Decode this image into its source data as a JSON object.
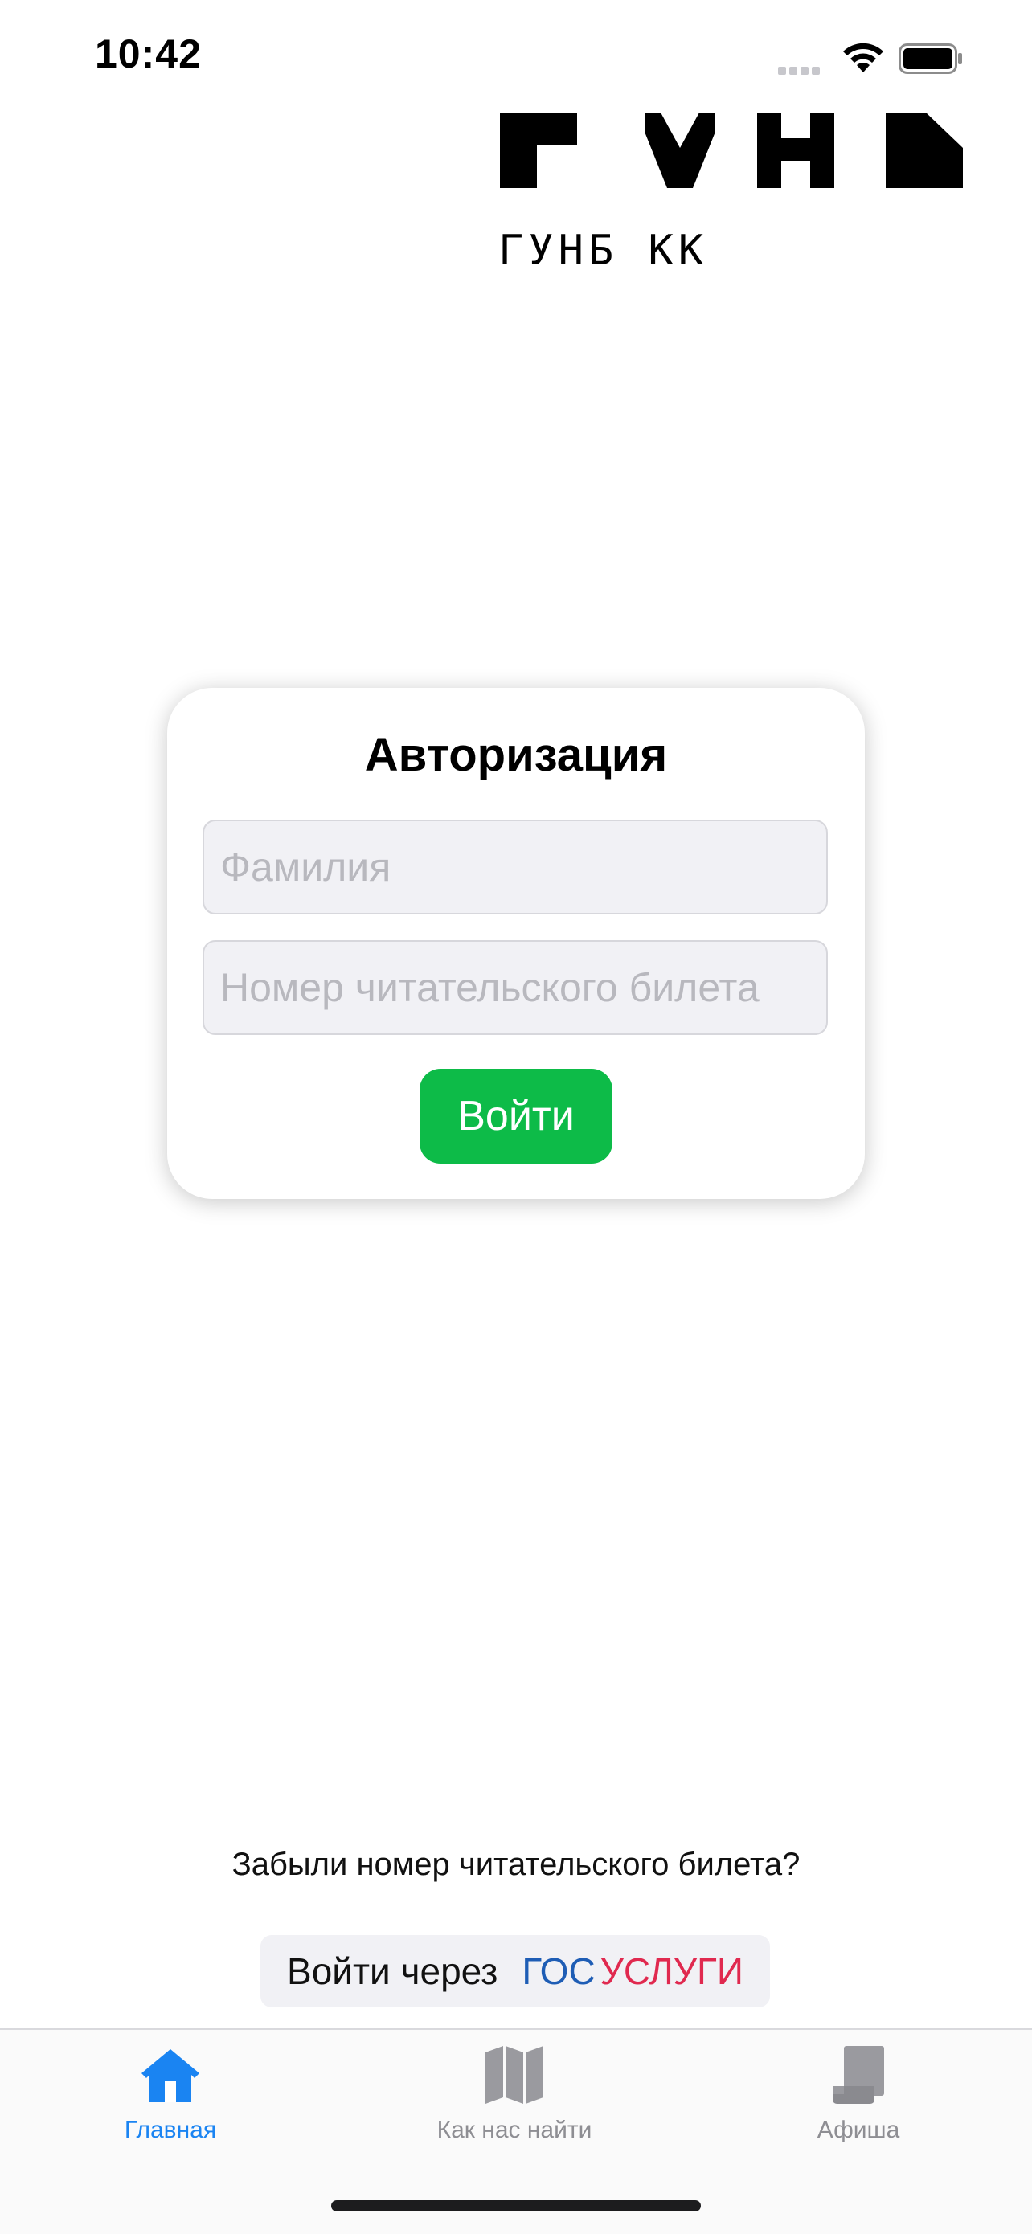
{
  "status_bar": {
    "time": "10:42"
  },
  "logo": {
    "caption": "ГУНБ КК"
  },
  "auth": {
    "title": "Авторизация",
    "surname_placeholder": "Фамилия",
    "surname_value": "",
    "card_placeholder": "Номер читательского билета",
    "card_value": "",
    "login_label": "Войти",
    "login_color": "#0dbb48"
  },
  "links": {
    "forgot": "Забыли номер читательского билета?",
    "gosuslugi_prefix": "Войти через",
    "gosuslugi_gos": "ГОС",
    "gosuslugi_uslugi": "УСЛУГИ"
  },
  "tabs": [
    {
      "label": "Главная",
      "icon": "home-icon",
      "active": true
    },
    {
      "label": "Как нас найти",
      "icon": "map-icon",
      "active": false
    },
    {
      "label": "Афиша",
      "icon": "poster-icon",
      "active": false
    }
  ],
  "colors": {
    "active_tab": "#1a84f2",
    "inactive_tab": "#8e8e93",
    "gos_blue": "#1e5db5",
    "uslugi_red": "#e0294f"
  }
}
